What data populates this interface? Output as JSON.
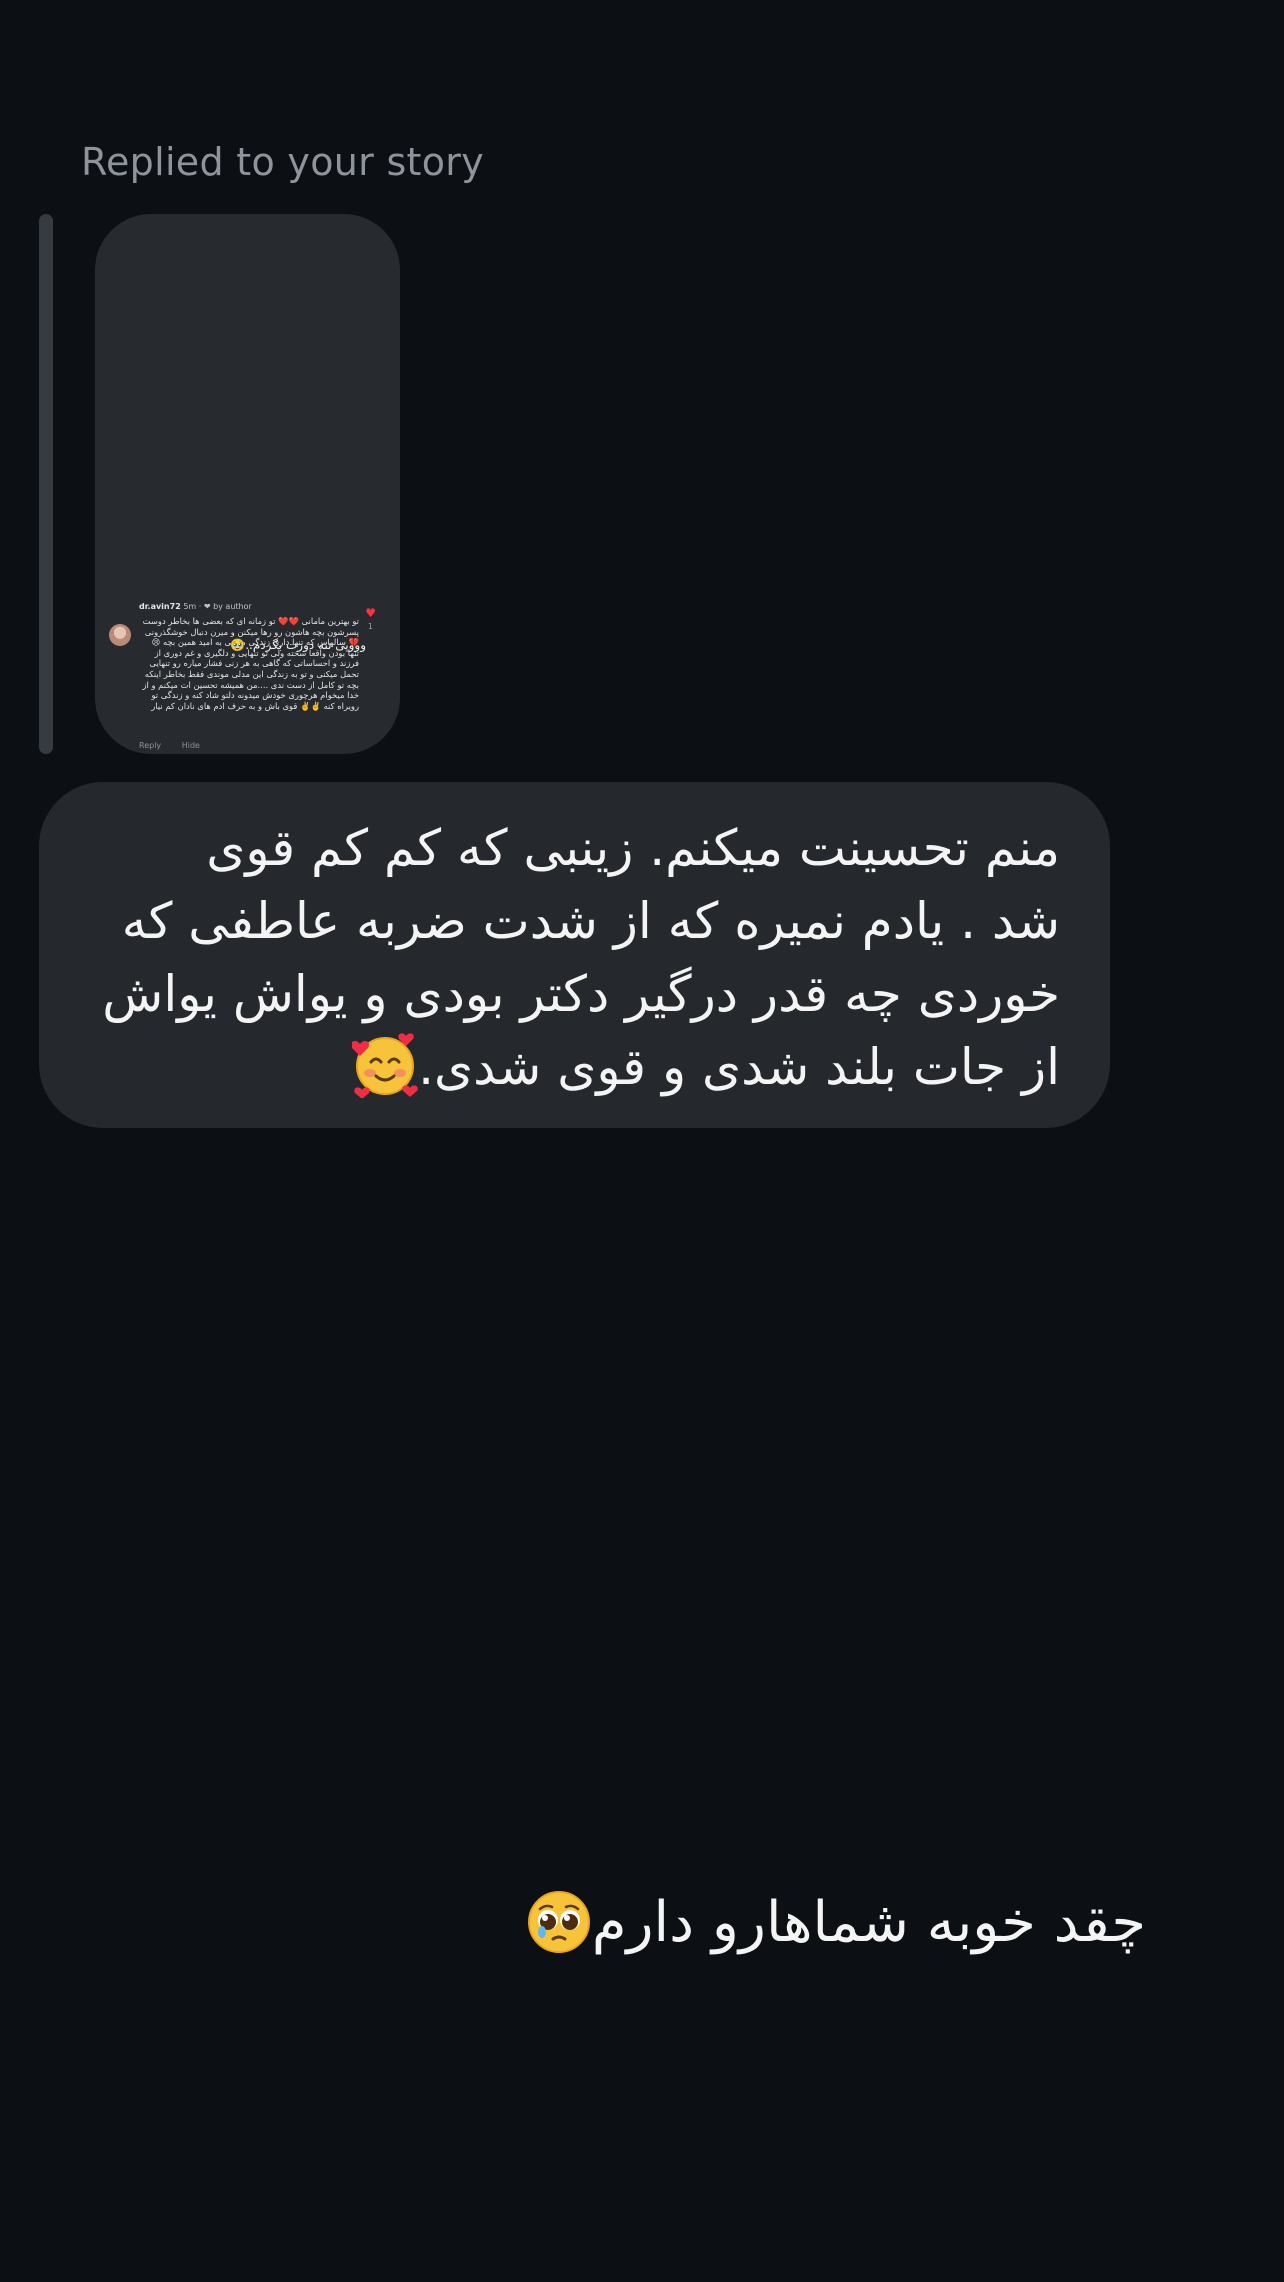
{
  "colors": {
    "background": "#0c1014",
    "bubble": "#25282d",
    "story_bg": "#272a2f",
    "label": "#8e939c",
    "heart": "#ff3040"
  },
  "header": {
    "replied_label": "Replied to your story"
  },
  "story": {
    "comment": {
      "username": "dr.avin72",
      "meta": "5m · ❤ by author",
      "text": "تو بهترین مامانی ❤️❤️ تو زمانه ای که بعضی ها بخاطر دوست پسرشون بچه هاشون رو رها میکنن و میرن دنبال خوشگذرونی 💔 سالهاس که تنها داری زندگی میکنی به امید همین بچه 😢 تنها بودن واقعا سخته ولی تو تنهایی و دلگیری و غم دوری از فرزند و احساساتی که گاهی به هر زنی فشار میاره رو تنهایی تحمل میکنی و تو به زندگی این مدلی موندی فقط بخاطر اینکه بچه تو کامل از دست ندی ....من همیشه تحسین ات میکنم و از خدا میخوام هرچوری خودش میدونه دلتو شاد کنه و زندگی تو رویراه کنه ✌️✌️ قوی باش و به حرف ادم های نادان کم نیار",
      "like_count": "1",
      "reply_label": "Reply",
      "hide_label": "Hide",
      "heart_icon": "heart-icon"
    },
    "caption": "وووپی ننه دورت بگردم..🥹"
  },
  "messages": {
    "received": {
      "lines": [
        "منم تحسینت میکنم. زینبی که کم کم قوی",
        "شد . یادم نمیره که از شدت ضربه عاطفی که",
        "خوردی چه قدر درگیر دکتر بودی و یواش یواش",
        "از جات بلند شدی و قوی شدی."
      ],
      "emoji": "smiling-face-with-hearts"
    },
    "sent": {
      "text": "چقد خوبه شماهارو دارم",
      "emoji": "pleading-face"
    }
  }
}
